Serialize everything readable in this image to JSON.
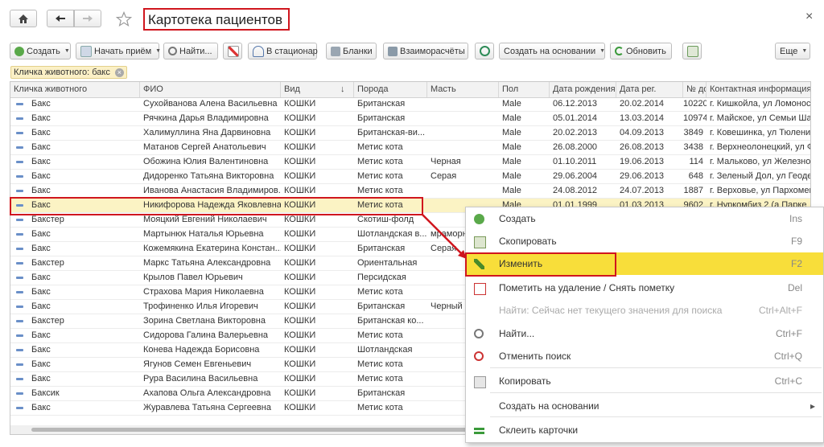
{
  "window": {
    "title": "Картотека пациентов",
    "close": "×"
  },
  "toolbar": {
    "create": "Создать",
    "start_visit": "Начать приём",
    "find": "Найти...",
    "hospital": "В стационар",
    "forms": "Бланки",
    "settlements": "Взаиморасчёты",
    "create_based": "Создать на основании",
    "refresh": "Обновить",
    "more": "Еще"
  },
  "filter": {
    "label": "Кличка животного: бакс"
  },
  "table": {
    "columns": [
      "Кличка животного",
      "ФИО",
      "Вид",
      "Порода",
      "Масть",
      "Пол",
      "Дата рождения",
      "Дата рег.",
      "№ дог.",
      "Контактная информация"
    ],
    "sort_indicator": "↓",
    "rows": [
      [
        "Бакс",
        "Сухойванова Алена Васильевна",
        "КОШКИ",
        "Британская",
        "",
        "Male",
        "06.12.2013",
        "20.02.2014",
        "10220",
        "г. Кишкойла, ул Ломоносо"
      ],
      [
        "Бакс",
        "Рячкина Дарья Владимировна",
        "КОШКИ",
        "Британская",
        "",
        "Male",
        "05.01.2014",
        "13.03.2014",
        "10974",
        "г. Майское, ул Семьи Шап"
      ],
      [
        "Бакс",
        "Халимуллина Яна Дарвиновна",
        "КОШКИ",
        "Британская-ви...",
        "",
        "Male",
        "20.02.2013",
        "04.09.2013",
        "3849",
        "г. Ковешинка, ул Тюленин"
      ],
      [
        "Бакс",
        "Матанов Сергей Анатольевич",
        "КОШКИ",
        "Метис кота",
        "",
        "Male",
        "26.08.2000",
        "26.08.2013",
        "3438",
        "г. Верхнеолонецкий, ул Ф"
      ],
      [
        "Бакс",
        "Обожина Юлия Валентиновна",
        "КОШКИ",
        "Метис кота",
        "Черная",
        "Male",
        "01.10.2011",
        "19.06.2013",
        "114",
        "г. Мальково, ул Железно"
      ],
      [
        "Бакс",
        "Дидоренко Татьяна Викторовна",
        "КОШКИ",
        "Метис кота",
        "Серая",
        "Male",
        "29.06.2004",
        "29.06.2013",
        "648",
        "г. Зеленый Дол, ул Геоде"
      ],
      [
        "Бакс",
        "Иванова Анастасия Владимиров...",
        "КОШКИ",
        "Метис кота",
        "",
        "Male",
        "24.08.2012",
        "24.07.2013",
        "1887",
        "г. Верховье, ул Пархомен"
      ],
      [
        "Бакс",
        "Никифорова Надежда Яковлевна",
        "КОШКИ",
        "Метис кота",
        "",
        "Male",
        "01.01.1999",
        "01.03.2013",
        "9602",
        "г. Нуркомбиз 2 (а Парке"
      ],
      [
        "Бакстер",
        "Мояцкий Евгений Николаевич",
        "КОШКИ",
        "Скотиш-фолд",
        "",
        "",
        "",
        "",
        "",
        ""
      ],
      [
        "Бакс",
        "Мартынюк Наталья Юрьевна",
        "КОШКИ",
        "Шотландская в...",
        "мраморн",
        "",
        "",
        "",
        "",
        ""
      ],
      [
        "Бакс",
        "Кожемякина Екатерина Констан...",
        "КОШКИ",
        "Британская",
        "Серая",
        "",
        "",
        "",
        "",
        ""
      ],
      [
        "Бакстер",
        "Маркс Татьяна Александровна",
        "КОШКИ",
        "Ориентальная",
        "",
        "",
        "",
        "",
        "",
        ""
      ],
      [
        "Бакс",
        "Крылов Павел Юрьевич",
        "КОШКИ",
        "Персидская",
        "",
        "",
        "",
        "",
        "",
        ""
      ],
      [
        "Бакс",
        "Страхова Мария Николаевна",
        "КОШКИ",
        "Метис кота",
        "",
        "",
        "",
        "",
        "",
        ""
      ],
      [
        "Бакс",
        "Трофиненко Илья Игоревич",
        "КОШКИ",
        "Британская",
        "Черный",
        "",
        "",
        "",
        "",
        ""
      ],
      [
        "Бакстер",
        "Зорина Светлана Викторовна",
        "КОШКИ",
        "Британская ко...",
        "",
        "",
        "",
        "",
        "",
        ""
      ],
      [
        "Бакс",
        "Сидорова Галина Валерьевна",
        "КОШКИ",
        "Метис кота",
        "",
        "",
        "",
        "",
        "",
        ""
      ],
      [
        "Бакс",
        "Конева Надежда Борисовна",
        "КОШКИ",
        "Шотландская",
        "",
        "",
        "",
        "",
        "",
        ""
      ],
      [
        "Бакс",
        "Ягунов Семен Евгеньевич",
        "КОШКИ",
        "Метис кота",
        "",
        "",
        "",
        "",
        "",
        ""
      ],
      [
        "Бакс",
        "Рура Василина Васильевна",
        "КОШКИ",
        "Метис кота",
        "",
        "",
        "",
        "",
        "",
        ""
      ],
      [
        "Баксик",
        "Ахапова Ольга Александровна",
        "КОШКИ",
        "Британская",
        "",
        "",
        "",
        "",
        "",
        ""
      ],
      [
        "Бакс",
        "Журавлева Татьяна Сергеевна",
        "КОШКИ",
        "Метис кота",
        "",
        "",
        "",
        "",
        "",
        ""
      ]
    ]
  },
  "context_menu": {
    "items": [
      {
        "label": "Создать",
        "key": "Ins"
      },
      {
        "label": "Скопировать",
        "key": "F9"
      },
      {
        "label": "Изменить",
        "key": "F2"
      },
      {
        "label": "Пометить на удаление / Снять пометку",
        "key": "Del"
      },
      {
        "label": "Найти: Сейчас нет текущего значения для поиска",
        "key": "Ctrl+Alt+F"
      },
      {
        "label": "Найти...",
        "key": "Ctrl+F"
      },
      {
        "label": "Отменить поиск",
        "key": "Ctrl+Q"
      },
      {
        "label": "Копировать",
        "key": "Ctrl+C"
      },
      {
        "label": "Создать на основании",
        "key": "▸"
      },
      {
        "label": "Склеить карточки",
        "key": ""
      }
    ]
  },
  "colors": {
    "accent_yellow": "#f8de3a",
    "selection": "#fbf3c4",
    "highlight_border": "#d0161e"
  }
}
